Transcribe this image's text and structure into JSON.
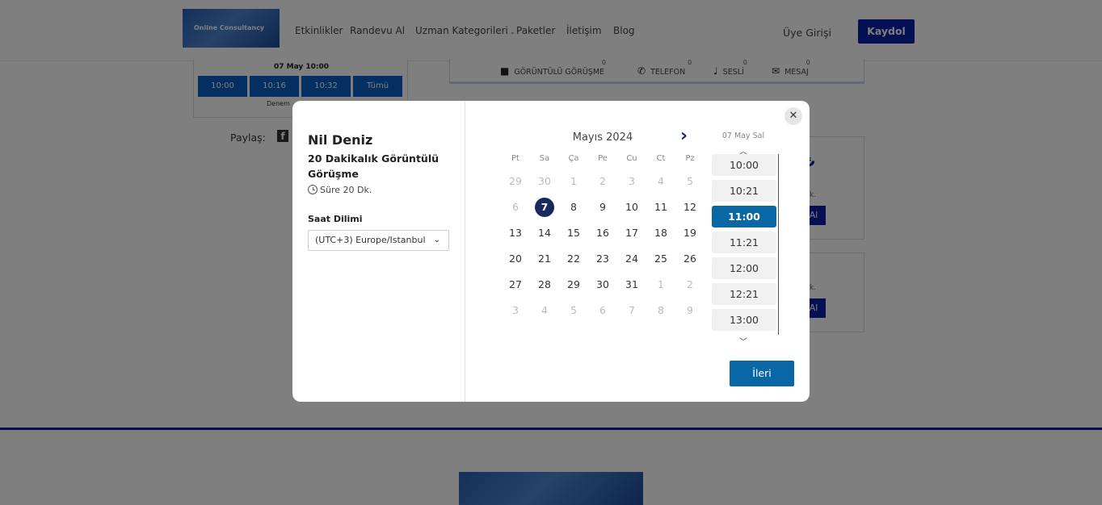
{
  "navbar": {
    "logo_text": "Online Consultancy",
    "links": [
      "Etkinlikler",
      "Randevu Al",
      "Uzman Kategorileri",
      "Paketler",
      "İletişim",
      "Blog"
    ],
    "login": "Üye Girişi",
    "signup": "Kaydol"
  },
  "background": {
    "slot_date": "07 May 10:00",
    "slots": [
      "10:00",
      "10:16",
      "10:32",
      "Tümü"
    ],
    "slot_name": "Denem",
    "share_label": "Paylaş:",
    "tabs": [
      {
        "label": "GÖRÜNTÜLÜ GÖRÜŞME",
        "count": "0"
      },
      {
        "label": "TELEFON",
        "count": "0"
      },
      {
        "label": "SESLİ",
        "count": "0"
      },
      {
        "label": "MESAJ",
        "count": "0"
      }
    ],
    "package_sub": "k.",
    "package_btn": "Al"
  },
  "modal": {
    "expert_name": "Nil Deniz",
    "service": "20 Dakikalık Görüntülü Görüşme",
    "duration": "Süre 20 Dk.",
    "timezone_label": "Saat Dilimi",
    "timezone_value": "(UTC+3) Europe/Istanbul",
    "calendar": {
      "month": "Mayıs 2024",
      "weekdays": [
        "Pt",
        "Sa",
        "Ça",
        "Pe",
        "Cu",
        "Ct",
        "Pz"
      ],
      "weeks": [
        [
          "29",
          "30",
          "1",
          "2",
          "3",
          "4",
          "5"
        ],
        [
          "6",
          "7",
          "8",
          "9",
          "10",
          "11",
          "12"
        ],
        [
          "13",
          "14",
          "15",
          "16",
          "17",
          "18",
          "19"
        ],
        [
          "20",
          "21",
          "22",
          "23",
          "24",
          "25",
          "26"
        ],
        [
          "27",
          "28",
          "29",
          "30",
          "31",
          "1",
          "2"
        ],
        [
          "3",
          "4",
          "5",
          "6",
          "7",
          "8",
          "9"
        ]
      ],
      "selected_day": "7"
    },
    "time_header": "07 May Sal",
    "times": [
      "10:00",
      "10:21",
      "11:00",
      "11:21",
      "12:00",
      "12:21",
      "13:00"
    ],
    "selected_time": "11:00",
    "next_button": "İleri"
  }
}
